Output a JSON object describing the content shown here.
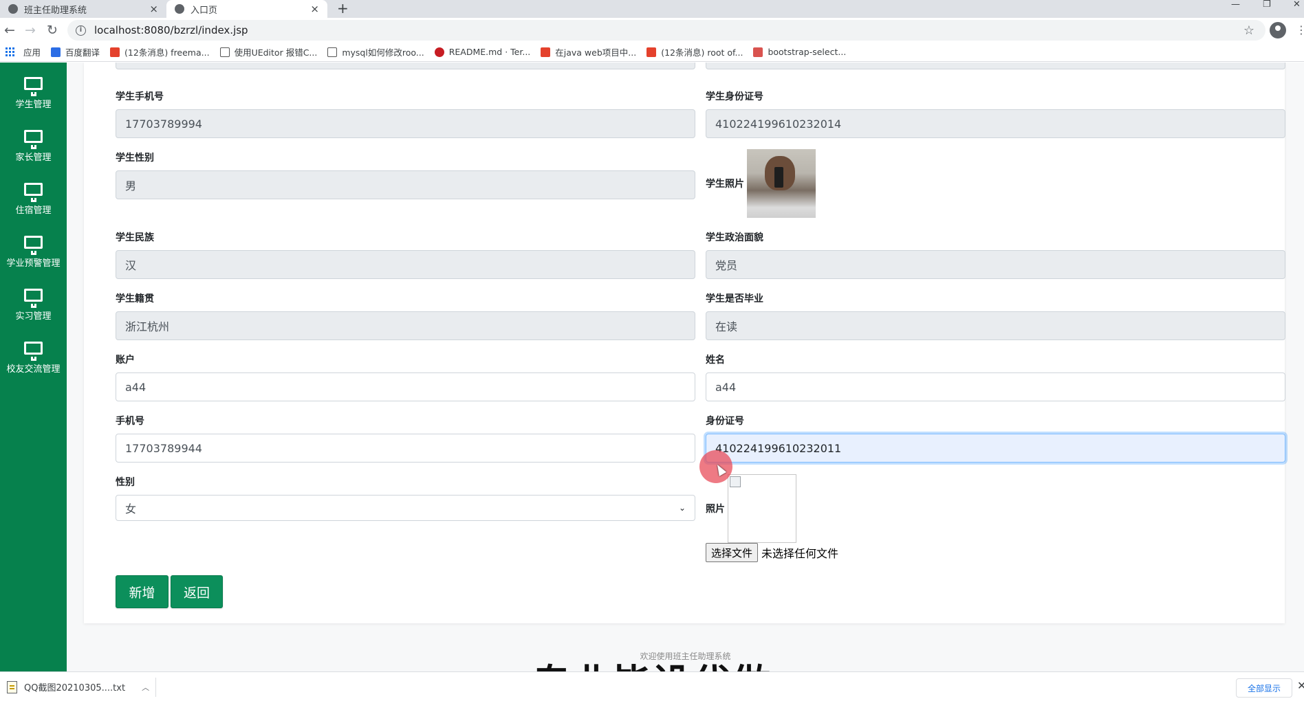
{
  "browser": {
    "tabs": [
      {
        "title": "班主任助理系统",
        "close": "×"
      },
      {
        "title": "入口页",
        "close": "×"
      }
    ],
    "new_tab": "+",
    "window_controls": {
      "minimize": "—",
      "restore": "❐",
      "close": "✕"
    },
    "url": "localhost:8080/bzrzl/index.jsp",
    "bookmarks": [
      {
        "label": "应用",
        "color": "#1a73e8"
      },
      {
        "label": "百度翻译",
        "color": "#2b6de5"
      },
      {
        "label": "(12条消息) freema...",
        "color": "#e4412c"
      },
      {
        "label": "使用UEditor 报错C...",
        "color": "#555555"
      },
      {
        "label": "mysql如何修改roo...",
        "color": "#555555"
      },
      {
        "label": "README.md · Ter...",
        "color": "#c71d23"
      },
      {
        "label": "在java web项目中...",
        "color": "#e4412c"
      },
      {
        "label": "(12条消息) root of...",
        "color": "#e4412c"
      },
      {
        "label": "bootstrap-select...",
        "color": "#d9534f"
      }
    ]
  },
  "sidebar": {
    "items": [
      {
        "label": "学生管理",
        "icon": "monitor-icon"
      },
      {
        "label": "家长管理",
        "icon": "monitor-icon"
      },
      {
        "label": "住宿管理",
        "icon": "monitor-icon"
      },
      {
        "label": "学业预警管理",
        "icon": "monitor-icon"
      },
      {
        "label": "实习管理",
        "icon": "monitor-icon"
      },
      {
        "label": "校友交流管理",
        "icon": "monitor-icon"
      }
    ]
  },
  "form": {
    "student_phone": {
      "label": "学生手机号",
      "value": "17703789994"
    },
    "student_id_card": {
      "label": "学生身份证号",
      "value": "410224199610232014"
    },
    "student_gender": {
      "label": "学生性别",
      "value": "男"
    },
    "student_photo": {
      "label": "学生照片"
    },
    "student_ethnicity": {
      "label": "学生民族",
      "value": "汉"
    },
    "student_political": {
      "label": "学生政治面貌",
      "value": "党员"
    },
    "student_hometown": {
      "label": "学生籍贯",
      "value": "浙江杭州"
    },
    "student_graduated": {
      "label": "学生是否毕业",
      "value": "在读"
    },
    "account": {
      "label": "账户",
      "value": "a44"
    },
    "name": {
      "label": "姓名",
      "value": "a44"
    },
    "phone": {
      "label": "手机号",
      "value": "17703789944"
    },
    "id_card": {
      "label": "身份证号",
      "value": "410224199610232011"
    },
    "gender": {
      "label": "性别",
      "value": "女"
    },
    "photo": {
      "label": "照片"
    },
    "file_button": "选择文件",
    "file_status": "未选择任何文件",
    "add_button": "新增",
    "back_button": "返回"
  },
  "footer": "欢迎使用班主任助理系统",
  "watermark": "专业毕设代做",
  "downloads": {
    "file": "QQ截图20210305....txt",
    "show_all": "全部显示",
    "close": "✕"
  }
}
